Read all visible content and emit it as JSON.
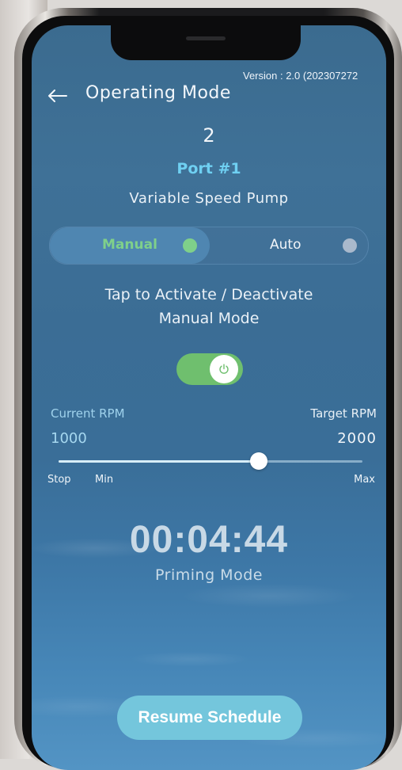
{
  "header": {
    "version_text": "Version : 2.0 (202307272",
    "title": "Operating Mode"
  },
  "port": {
    "number": "2",
    "name": "Port #1",
    "device_type": "Variable Speed Pump"
  },
  "mode_toggle": {
    "manual_label": "Manual",
    "auto_label": "Auto",
    "selected": "Manual",
    "manual_dot_color": "#7fd08a",
    "auto_dot_color": "#a9b9cc"
  },
  "instructions": {
    "line1": "Tap to Activate / Deactivate",
    "line2": "Manual Mode"
  },
  "power_switch": {
    "state": "on",
    "icon": "power-icon",
    "color": "#6fbf6e"
  },
  "rpm": {
    "current_label": "Current RPM",
    "current_value": "1000",
    "target_label": "Target RPM",
    "target_value": "2000",
    "slider_level": 0.66,
    "scale_stop": "Stop",
    "scale_min": "Min",
    "scale_max": "Max"
  },
  "timer": {
    "time": "00:04:44",
    "status": "Priming Mode"
  },
  "actions": {
    "resume_label": "Resume Schedule"
  },
  "colors": {
    "accent_port": "#6fd0f2",
    "accent_green": "#7fd08a",
    "button_bg": "#74c6dc"
  }
}
